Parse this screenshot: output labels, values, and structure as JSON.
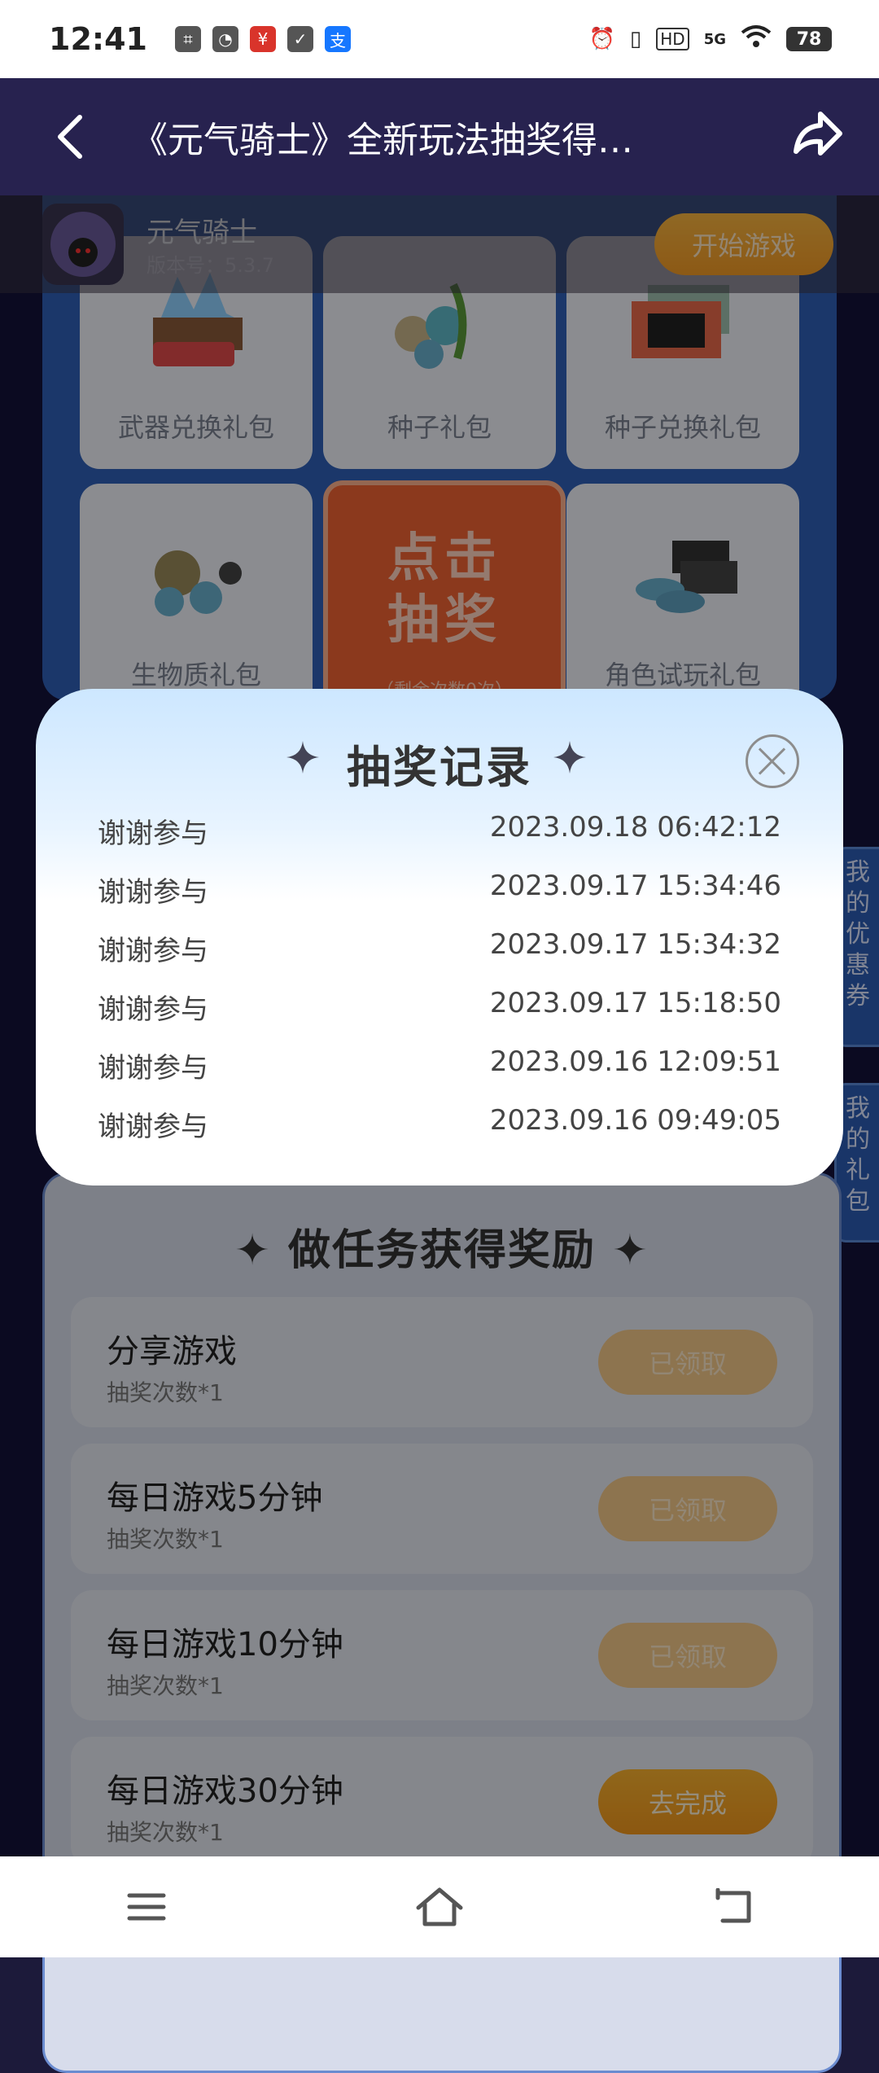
{
  "status": {
    "time": "12:41",
    "battery": "78",
    "network": "5G",
    "hd": "HD",
    "left_icons": [
      "scan-icon",
      "wechat-icon",
      "hongbao-icon",
      "shield-icon",
      "alipay-icon"
    ]
  },
  "header": {
    "title": "《元气骑士》全新玩法抽奖得…"
  },
  "game": {
    "name": "元气骑士",
    "version": "版本号：5.3.7",
    "start_label": "开始游戏"
  },
  "prizes": [
    {
      "label": "武器兑换礼包"
    },
    {
      "label": "种子礼包"
    },
    {
      "label": "种子兑换礼包"
    },
    {
      "label": "生物质礼包"
    },
    {
      "label": "角色试玩礼包"
    }
  ],
  "draw": {
    "line1": "点击",
    "line2": "抽奖",
    "remaining": "（剩余次数0次）"
  },
  "side_tabs": {
    "coupons": "我的优惠券",
    "gifts": "我的礼包"
  },
  "modal": {
    "title": "抽奖记录",
    "records": [
      {
        "result": "谢谢参与",
        "time": "2023.09.18 06:42:12"
      },
      {
        "result": "谢谢参与",
        "time": "2023.09.17 15:34:46"
      },
      {
        "result": "谢谢参与",
        "time": "2023.09.17 15:34:32"
      },
      {
        "result": "谢谢参与",
        "time": "2023.09.17 15:18:50"
      },
      {
        "result": "谢谢参与",
        "time": "2023.09.16 12:09:51"
      },
      {
        "result": "谢谢参与",
        "time": "2023.09.16 09:49:05"
      }
    ]
  },
  "tasks": {
    "title": "做任务获得奖励",
    "items": [
      {
        "name": "分享游戏",
        "sub": "抽奖次数*1",
        "button": "已领取"
      },
      {
        "name": "每日游戏5分钟",
        "sub": "抽奖次数*1",
        "button": "已领取"
      },
      {
        "name": "每日游戏10分钟",
        "sub": "抽奖次数*1",
        "button": "已领取"
      },
      {
        "name": "每日游戏30分钟",
        "sub": "抽奖次数*1",
        "button": "去完成"
      }
    ]
  }
}
